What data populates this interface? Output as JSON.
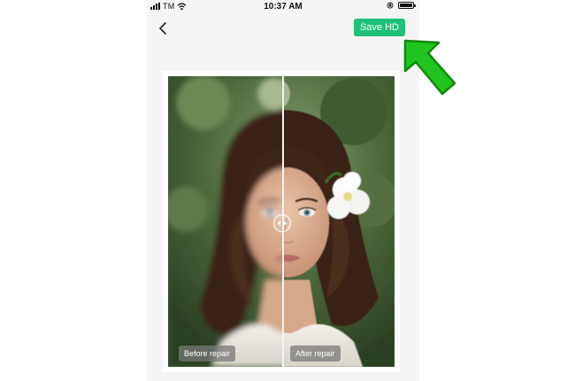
{
  "status_bar": {
    "carrier": "TM",
    "time": "10:37 AM"
  },
  "header": {
    "back_icon": "chevron-left-icon",
    "save_label": "Save HD"
  },
  "compare": {
    "before_label": "Before repair",
    "after_label": "After repair",
    "slider_icon": "left-right-arrows-icon"
  },
  "annotation": {
    "arrow_icon": "pointer-arrow-icon",
    "arrow_color": "#22c51f"
  },
  "colors": {
    "accent": "#1fc07a",
    "background": "#f5f5f5"
  }
}
